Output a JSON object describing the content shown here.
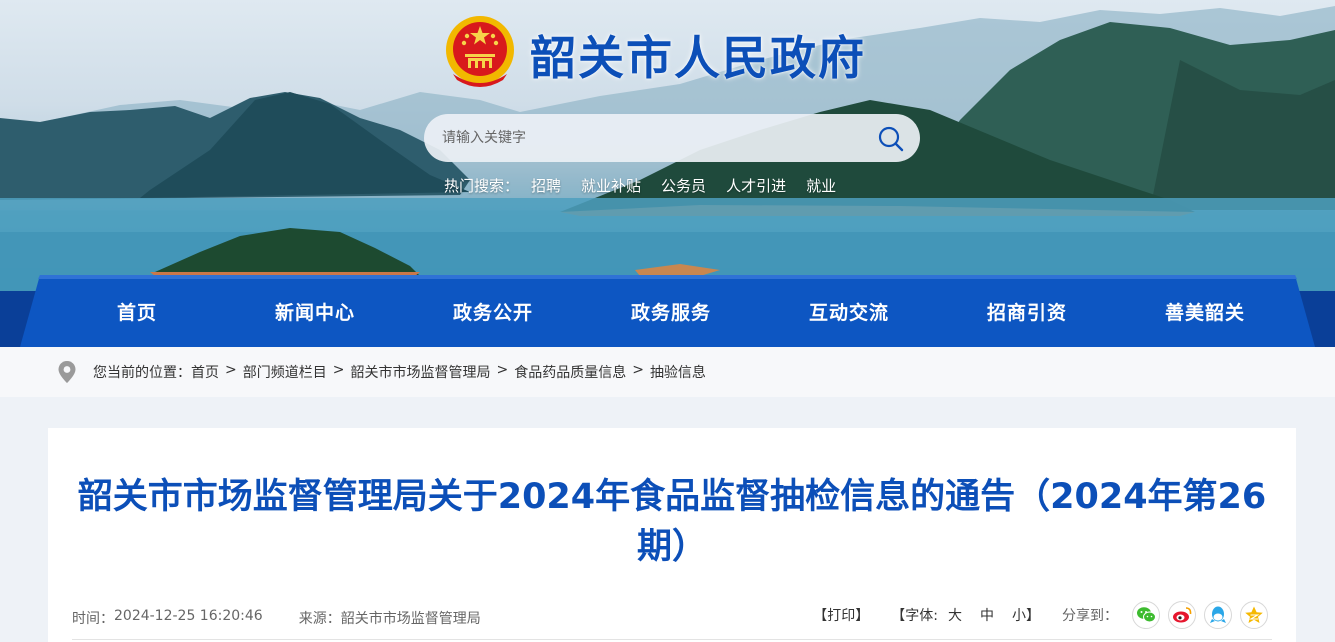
{
  "header": {
    "site_title": "韶关市人民政府"
  },
  "search": {
    "placeholder": "请输入关键字"
  },
  "hot_search": {
    "label": "热门搜索：",
    "items": [
      "招聘",
      "就业补贴",
      "公务员",
      "人才引进",
      "就业"
    ]
  },
  "nav": {
    "items": [
      "首页",
      "新闻中心",
      "政务公开",
      "政务服务",
      "互动交流",
      "招商引资",
      "善美韶关"
    ]
  },
  "breadcrumb": {
    "prefix": "您当前的位置：",
    "items": [
      "首页",
      "部门频道栏目",
      "韶关市市场监督管理局",
      "食品药品质量信息",
      "抽验信息"
    ],
    "separator": ">"
  },
  "article": {
    "title": "韶关市市场监督管理局关于2024年食品监督抽检信息的通告（2024年第26期）",
    "time_label": "时间：",
    "time": "2024-12-25 16:20:46",
    "source_label": "来源：",
    "source": "韶关市市场监督管理局"
  },
  "tools": {
    "print_label": "【打印】",
    "font_label": "【字体:",
    "font_large": "大",
    "font_medium": "中",
    "font_small": "小",
    "font_close": "】",
    "share_label": "分享到："
  },
  "share_icons": [
    "wechat-icon",
    "weibo-icon",
    "qq-icon",
    "qzone-icon"
  ],
  "colors": {
    "brand_blue": "#0c4fb8",
    "nav_blue": "#0d56c2",
    "wechat": "#3dbb2f",
    "weibo": "#e6162d",
    "qq": "#2aa7e8",
    "qzone": "#f5b800"
  }
}
